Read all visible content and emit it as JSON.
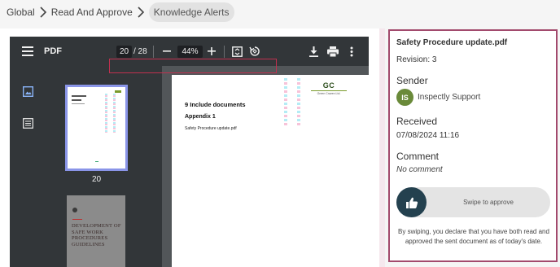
{
  "breadcrumb": {
    "items": [
      "Global",
      "Read And Approve",
      "Knowledge Alerts"
    ]
  },
  "pdf_viewer": {
    "title": "PDF",
    "current_page": "20",
    "page_total": "/ 28",
    "zoom": "44%",
    "thumbnail_page_number": "20",
    "icons": [
      "menu-icon",
      "zoom-out-icon",
      "zoom-in-icon",
      "fit-page-icon",
      "rotate-icon",
      "download-icon",
      "print-icon",
      "more-vert-icon",
      "thumbnails-icon",
      "outline-icon"
    ],
    "page": {
      "heading": "9 Include documents",
      "subheading": "Appendix 1",
      "body": "Safety Procedure update.pdf",
      "logo_text": "GC",
      "logo_sub": "Green Craven Ltd."
    },
    "thumb2_title": "DEVELOPMENT OF SAFE WORK PROCEDURES GUIDELINES"
  },
  "panel": {
    "file_name": "Safety Procedure update.pdf",
    "revision": "Revision: 3",
    "sender_title": "Sender",
    "sender_initials": "IS",
    "sender_name": "Inspectly Support",
    "received_title": "Received",
    "received_date": "07/08/2024 11:16",
    "comment_title": "Comment",
    "comment_text": "No comment",
    "swipe_label": "Swipe to approve",
    "disclaimer": "By swiping, you declare that you have both read and approved the sent document as of today's date."
  },
  "colors": {
    "panel_border": "#a24a6d",
    "avatar_bg": "#6a8a3a",
    "swipe_knob": "#24414f",
    "thumb_selected": "#8a95e8",
    "pdf_toolbar": "#323639"
  }
}
